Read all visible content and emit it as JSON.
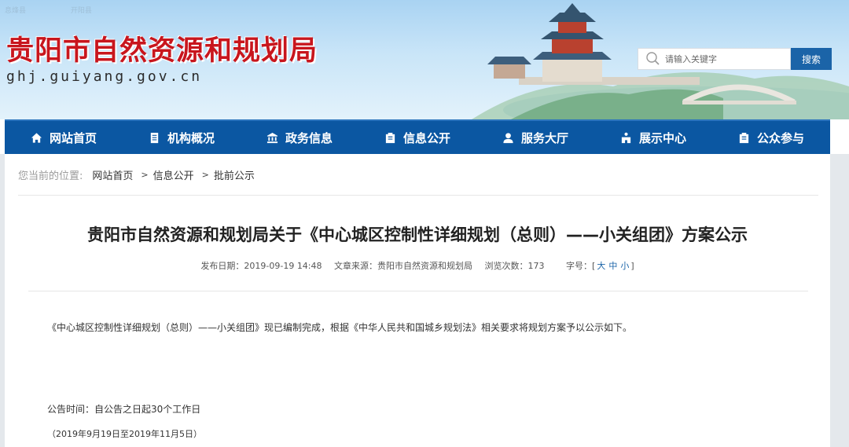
{
  "header": {
    "map_labels": [
      "息烽县",
      "开阳县"
    ],
    "site_title": "贵阳市自然资源和规划局",
    "site_url": "ghj.guiyang.gov.cn"
  },
  "search": {
    "placeholder": "请输入关键字",
    "button_label": "搜索"
  },
  "nav": {
    "items": [
      {
        "label": "网站首页",
        "icon": "home-icon"
      },
      {
        "label": "机构概况",
        "icon": "document-icon"
      },
      {
        "label": "政务信息",
        "icon": "bank-icon"
      },
      {
        "label": "信息公开",
        "icon": "clipboard-icon"
      },
      {
        "label": "服务大厅",
        "icon": "user-icon"
      },
      {
        "label": "展示中心",
        "icon": "display-icon"
      },
      {
        "label": "公众参与",
        "icon": "clipboard-icon"
      }
    ]
  },
  "breadcrumb": {
    "lead": "您当前的位置:",
    "items": [
      "网站首页",
      "信息公开",
      "批前公示"
    ]
  },
  "article": {
    "title": "贵阳市自然资源和规划局关于《中心城区控制性详细规划（总则）——小关组团》方案公示",
    "meta": {
      "publish_date": "发布日期：2019-09-19 14:48",
      "source": "文章来源：贵阳市自然资源和规划局",
      "views": "浏览次数：173",
      "font_size_label": "字号：[",
      "font_sizes": [
        "大",
        "中",
        "小"
      ],
      "font_size_close": "]"
    },
    "paragraphs": [
      "《中心城区控制性详细规划（总则）——小关组团》现已编制完成，根据《中华人民共和国城乡规划法》相关要求将规划方案予以公示如下。",
      "公告时间：自公告之日起30个工作日",
      "（2019年9月19日至2019年11月5日）"
    ]
  },
  "colors": {
    "title_red": "#c8161d",
    "nav_blue": "#0b57a2",
    "button_blue": "#1b64a8"
  }
}
